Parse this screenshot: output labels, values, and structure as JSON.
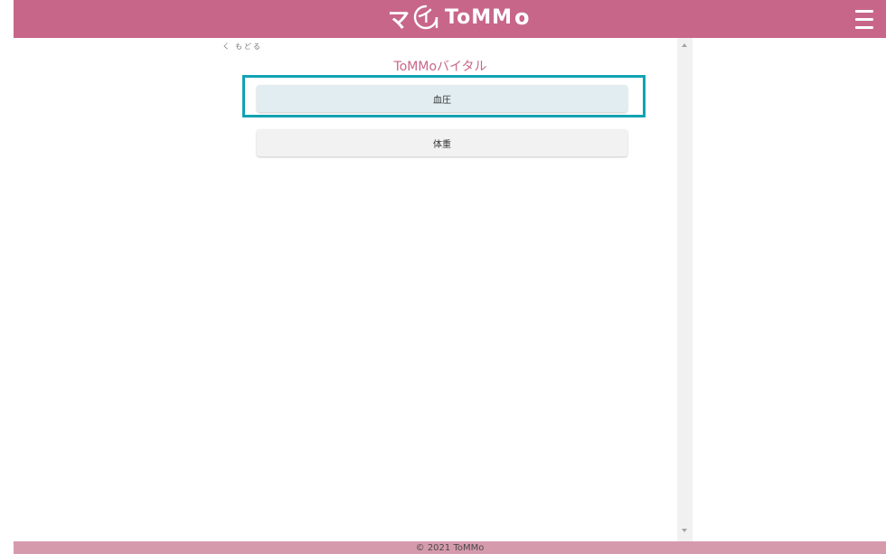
{
  "header": {
    "logo": {
      "ma": "マ",
      "i": "イ",
      "word": "ToMM",
      "tail": "o"
    },
    "menu_icon": "hamburger-menu-icon",
    "color": "#c8668a"
  },
  "nav": {
    "back_chevron": "く",
    "back_label": "もどる"
  },
  "page": {
    "title": "ToMMoバイタル"
  },
  "menu": {
    "items": [
      {
        "label": "血圧",
        "selected": true
      },
      {
        "label": "体重",
        "selected": false
      }
    ]
  },
  "highlight_color": "#12a3b3",
  "footer": {
    "text": "© 2021 ToMMo"
  }
}
